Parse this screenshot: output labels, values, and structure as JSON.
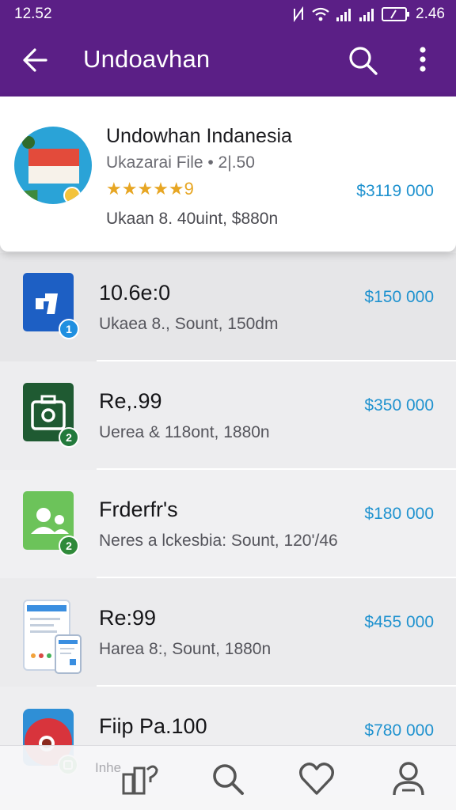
{
  "status_bar": {
    "time": "12.52",
    "clock": "2.46",
    "icons": [
      "nfc-icon",
      "wifi-icon",
      "signal-icon",
      "signal-icon",
      "battery-icon"
    ]
  },
  "app_bar": {
    "title": "Undoavhan",
    "back_icon": "arrow-left-icon",
    "search_icon": "search-icon",
    "more_icon": "more-vertical-icon"
  },
  "featured": {
    "name": "Undowhan Indanesia",
    "meta": "Ukazarai File • 2|.50",
    "rating_text": "★★★★★9",
    "rating_value": 9,
    "detail": "Ukaan 8. 40uint, $880n",
    "price": "$3119 000",
    "avatar_icon": "indonesia-flag-icon"
  },
  "items": [
    {
      "name": "10.6e:0",
      "detail": "Ukaea  8., Sount, 150dm",
      "price": "$150 000",
      "badge": "1",
      "icon": "music-app-icon",
      "color": "#1d5fc4",
      "badge_color": "#1f8fe0"
    },
    {
      "name": "Re,.99",
      "detail": "Uerea  & 118ont, 1880n",
      "price": "$350 000",
      "badge": "2",
      "icon": "camera-bag-icon",
      "color": "#1f5a32",
      "badge_color": "#237a3c"
    },
    {
      "name": "Frderfr's",
      "detail": "Neres  a lckesbia: Sount, 120'/46",
      "price": "$180 000",
      "badge": "2",
      "icon": "contacts-icon",
      "color": "#6cc35a",
      "badge_color": "#2f8a3a"
    },
    {
      "name": "Re:99",
      "detail": "Harea  8:, Sount, 1880n",
      "price": "$455 000",
      "badge": "",
      "icon": "devices-screen-icon",
      "color": "#eef3fb",
      "badge_color": ""
    },
    {
      "name": "Fiip Pa.100",
      "detail": "",
      "price": "$780 000",
      "badge": "",
      "icon": "red-app-icon",
      "color": "#d8343c",
      "badge_color": "#3aa54a"
    }
  ],
  "bottom_nav": {
    "hint": "Inhe",
    "items": [
      {
        "icon": "home-grid-icon"
      },
      {
        "icon": "search-icon"
      },
      {
        "icon": "heart-icon"
      },
      {
        "icon": "profile-icon"
      }
    ]
  }
}
